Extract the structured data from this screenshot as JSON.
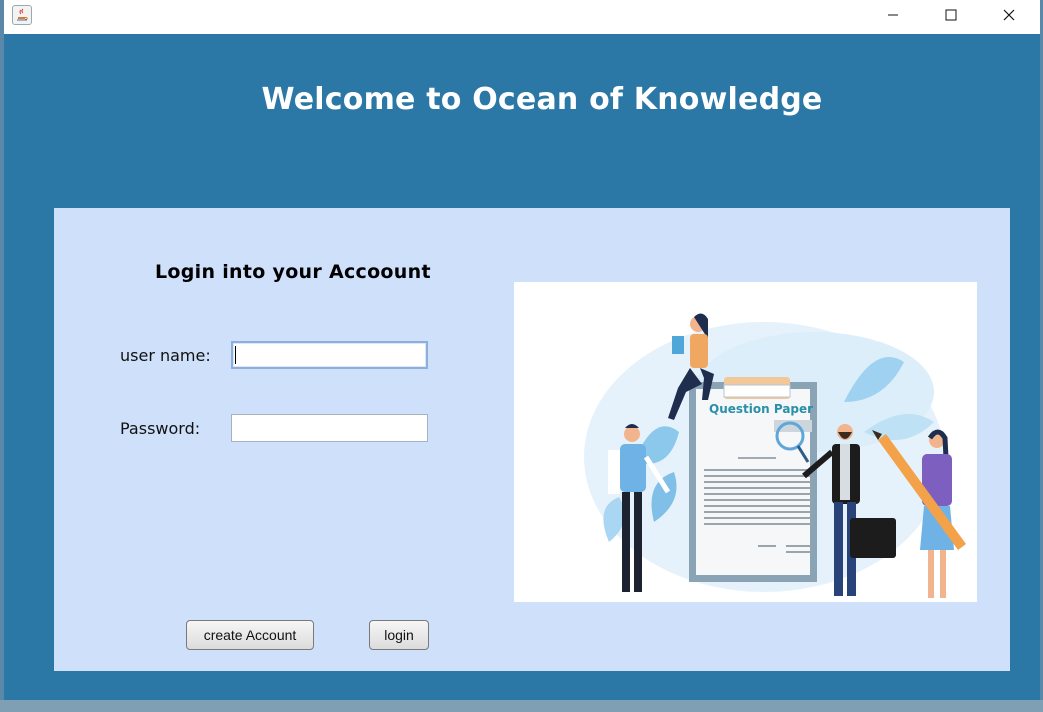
{
  "window": {
    "title": "",
    "controls": {
      "minimize": "minimize-icon",
      "maximize": "maximize-icon",
      "close": "close-icon"
    }
  },
  "header": {
    "title": "Welcome to Ocean of Knowledge"
  },
  "login": {
    "title": "Login into your Accoount",
    "username_label": "user name:",
    "username_value": "",
    "password_label": "Password:",
    "password_value": ""
  },
  "buttons": {
    "create_account": "create Account",
    "login": "login"
  },
  "illustration": {
    "caption": "Question Paper"
  },
  "colors": {
    "window_bg": "#2b78a6",
    "panel_bg": "#cfe0fb",
    "white": "#ffffff"
  }
}
